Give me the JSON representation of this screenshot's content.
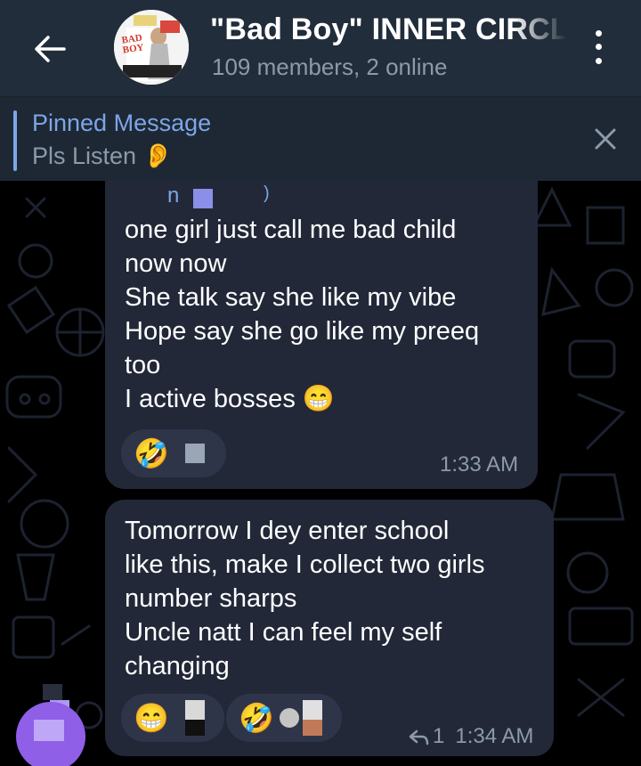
{
  "header": {
    "title": "\"Bad Boy\" INNER CIRCLE",
    "subtitle": "109 members, 2 online",
    "avatar_text": "BAD BOY"
  },
  "pinned": {
    "title": "Pinned Message",
    "text": "Pls Listen 👂"
  },
  "messages": [
    {
      "sender_initial": "n",
      "sender_suffix": ")",
      "text": "one girl just call me bad child\nnow now\nShe talk say she like my vibe\nHope say she go like my preeq\ntoo\nI active bosses 😁",
      "reactions": [
        {
          "emoji": "🤣"
        }
      ],
      "time": "1:33 AM"
    },
    {
      "text": "Tomorrow I dey enter school\nlike this, make I collect two girls\nnumber sharps\nUncle natt I can feel my self\nchanging",
      "reactions": [
        {
          "emoji": "😁"
        },
        {
          "emoji": "🤣"
        }
      ],
      "reply_count": "1",
      "time": "1:34 AM"
    }
  ],
  "colors": {
    "header_bg": "#212d3b",
    "pinned_bg": "#1e2835",
    "bubble_bg": "#222838",
    "accent": "#7da6e6",
    "muted": "#8c9aa9",
    "reaction_bg": "#2f3549"
  },
  "icons": {
    "back": "arrow-left-icon",
    "menu": "more-vertical-icon",
    "close": "close-icon",
    "reply": "reply-arrow-icon"
  }
}
